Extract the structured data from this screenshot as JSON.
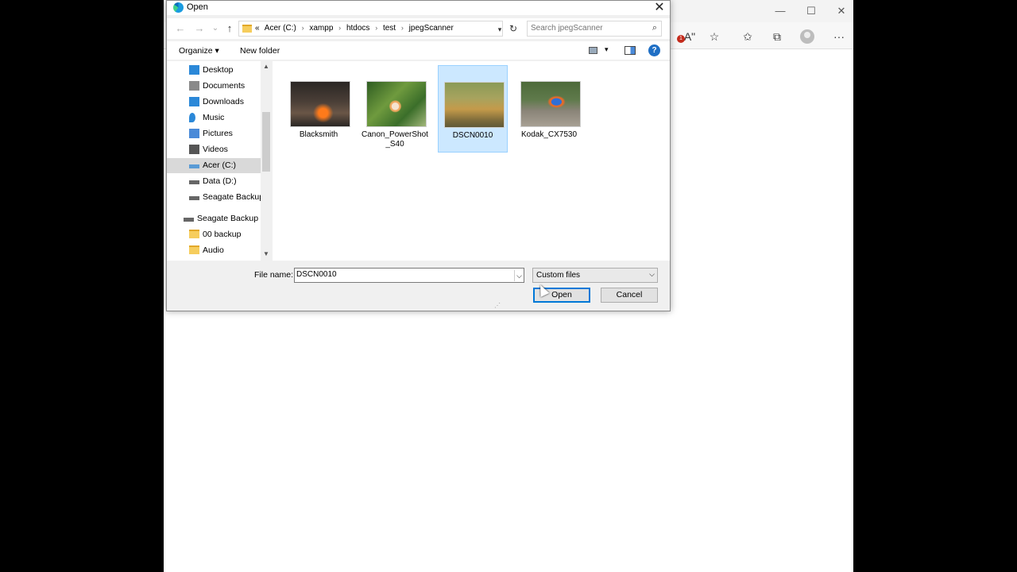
{
  "browser": {
    "window_controls": {
      "minimize": "—",
      "maximize": "☐",
      "close": "✕"
    },
    "toolbar_icons": {
      "read_aloud": "Aʺ",
      "add_favorite": "☆",
      "favorites": "✩",
      "collections": "⧉",
      "more": "···"
    },
    "notification_count": "1"
  },
  "dialog": {
    "title": "Open",
    "close": "✕",
    "nav": {
      "back": "←",
      "forward": "→",
      "recent": "⌄",
      "up": "↑",
      "refresh": "↻"
    },
    "breadcrumb": {
      "overflow": "«",
      "items": [
        "Acer (C:)",
        "xampp",
        "htdocs",
        "test",
        "jpegScanner"
      ],
      "separator": "›"
    },
    "search": {
      "placeholder": "Search jpegScanner",
      "value": ""
    },
    "commands": {
      "organize": "Organize ▾",
      "new_folder": "New folder",
      "view_dropdown": "▾",
      "help": "?"
    },
    "nav_pane": {
      "items": [
        {
          "label": "Desktop",
          "icon": "desktop-icon",
          "color": "#2b88d8"
        },
        {
          "label": "Documents",
          "icon": "documents-icon",
          "color": "#8a8a8a"
        },
        {
          "label": "Downloads",
          "icon": "downloads-icon",
          "color": "#2b88d8"
        },
        {
          "label": "Music",
          "icon": "music-icon",
          "color": "#2b88d8"
        },
        {
          "label": "Pictures",
          "icon": "pictures-icon",
          "color": "#4a8ad8"
        },
        {
          "label": "Videos",
          "icon": "videos-icon",
          "color": "#555555"
        },
        {
          "label": "Acer (C:)",
          "icon": "drive-c-icon",
          "color": "#5a9bd5",
          "selected": true
        },
        {
          "label": "Data (D:)",
          "icon": "drive-icon",
          "color": "#666666"
        },
        {
          "label": "Seagate Backup",
          "icon": "drive-icon",
          "color": "#666666"
        },
        {
          "label": "Seagate Backup P",
          "icon": "drive-icon",
          "color": "#666666"
        },
        {
          "label": "00 backup",
          "icon": "folder-icon",
          "color": "#f6cd5d"
        },
        {
          "label": "Audio",
          "icon": "folder-icon",
          "color": "#f6cd5d"
        }
      ],
      "scroll_up": "▲",
      "scroll_down": "▼"
    },
    "files": [
      {
        "name": "Blacksmith",
        "selected": false
      },
      {
        "name": "Canon_PowerShot_S40",
        "selected": false
      },
      {
        "name": "DSCN0010",
        "selected": true
      },
      {
        "name": "Kodak_CX7530",
        "selected": false
      }
    ],
    "bottom": {
      "file_name_label": "File name:",
      "file_name_value": "DSCN0010",
      "file_type": "Custom files",
      "open_button": "Open",
      "cancel_button": "Cancel",
      "dropdown_arrow": "⌵"
    }
  }
}
